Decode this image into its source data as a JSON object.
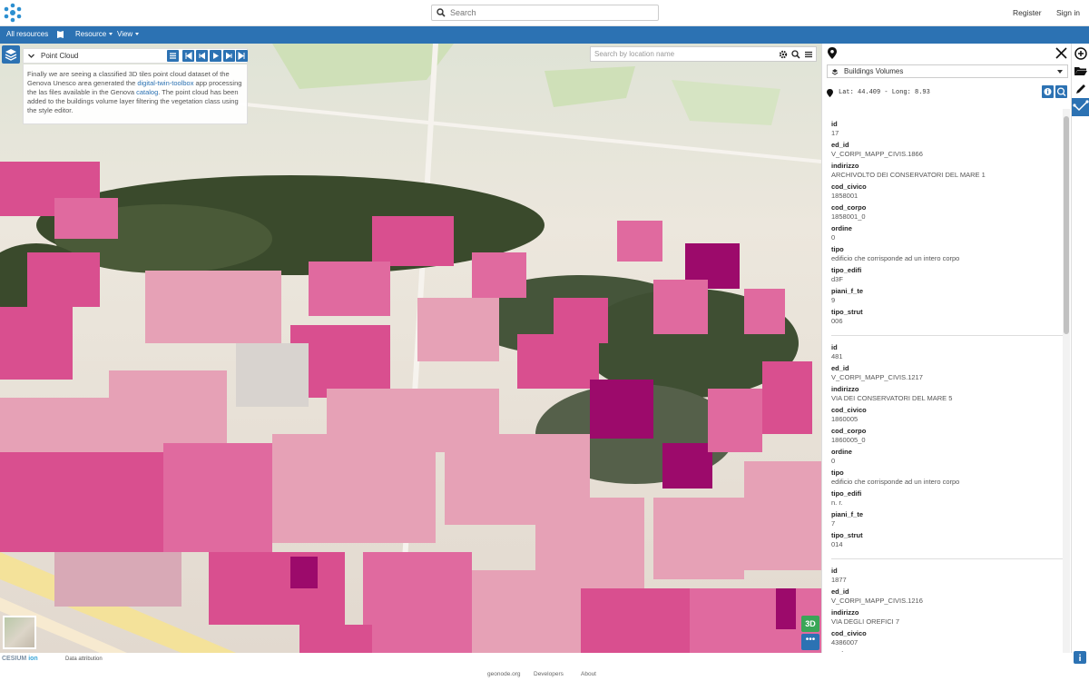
{
  "header": {
    "search_placeholder": "Search",
    "register": "Register",
    "signin": "Sign in"
  },
  "navbar": {
    "all_resources": "All resources",
    "resource": "Resource",
    "view": "View"
  },
  "map": {
    "panel_title": "Point Cloud",
    "desc_part1": "Finally we are seeing a classified 3D tiles point cloud dataset of the Genova Unesco area generated the ",
    "desc_link1": "digital-twin-toolbox",
    "desc_part2": " app processing the las files available in the Genova ",
    "desc_link2": "catalog",
    "desc_part3": ". The point cloud has been added to the buildings volume layer filtering the vegetation class using the style editor.",
    "search_placeholder": "Search by location name",
    "btn_3d": "3D",
    "btn_more": "•••",
    "cesium_a": "CESIUM",
    "cesium_b": "ion",
    "data_attribution": "Data attribution",
    "colors": {
      "building": "#d94f8f",
      "building_light": "#e6a1b6",
      "building_dark": "#9c0a6b",
      "vegetation": "#3a4a2c",
      "ground": "#e8e2da",
      "accent": "#2c72b3"
    }
  },
  "identify": {
    "layer_name": "Buildings Volumes",
    "coordinates": "Lat: 44.409 - Long: 8.93",
    "records": [
      [
        {
          "key": "id",
          "value": "17"
        },
        {
          "key": "ed_id",
          "value": "V_CORPI_MAPP_CIVIS.1866"
        },
        {
          "key": "indirizzo",
          "value": "ARCHIVOLTO DEI CONSERVATORI DEL MARE 1"
        },
        {
          "key": "cod_civico",
          "value": "1858001"
        },
        {
          "key": "cod_corpo",
          "value": "1858001_0"
        },
        {
          "key": "ordine",
          "value": "0"
        },
        {
          "key": "tipo",
          "value": "edificio che corrisponde ad un intero corpo"
        },
        {
          "key": "tipo_edifi",
          "value": "d3F"
        },
        {
          "key": "piani_f_te",
          "value": "9"
        },
        {
          "key": "tipo_strut",
          "value": "006"
        }
      ],
      [
        {
          "key": "id",
          "value": "481"
        },
        {
          "key": "ed_id",
          "value": "V_CORPI_MAPP_CIVIS.1217"
        },
        {
          "key": "indirizzo",
          "value": "VIA DEI CONSERVATORI DEL MARE 5"
        },
        {
          "key": "cod_civico",
          "value": "1860005"
        },
        {
          "key": "cod_corpo",
          "value": "1860005_0"
        },
        {
          "key": "ordine",
          "value": "0"
        },
        {
          "key": "tipo",
          "value": "edificio che corrisponde ad un intero corpo"
        },
        {
          "key": "tipo_edifi",
          "value": "n. r."
        },
        {
          "key": "piani_f_te",
          "value": "7"
        },
        {
          "key": "tipo_strut",
          "value": "014"
        }
      ],
      [
        {
          "key": "id",
          "value": "1877"
        },
        {
          "key": "ed_id",
          "value": "V_CORPI_MAPP_CIVIS.1216"
        },
        {
          "key": "indirizzo",
          "value": "VIA DEGLI OREFICI 7"
        },
        {
          "key": "cod_civico",
          "value": "4386007"
        },
        {
          "key": "cod_corpo",
          "value": ""
        }
      ]
    ]
  },
  "footer": {
    "geonode": "geonode.org",
    "developers": "Developers",
    "about": "About"
  }
}
